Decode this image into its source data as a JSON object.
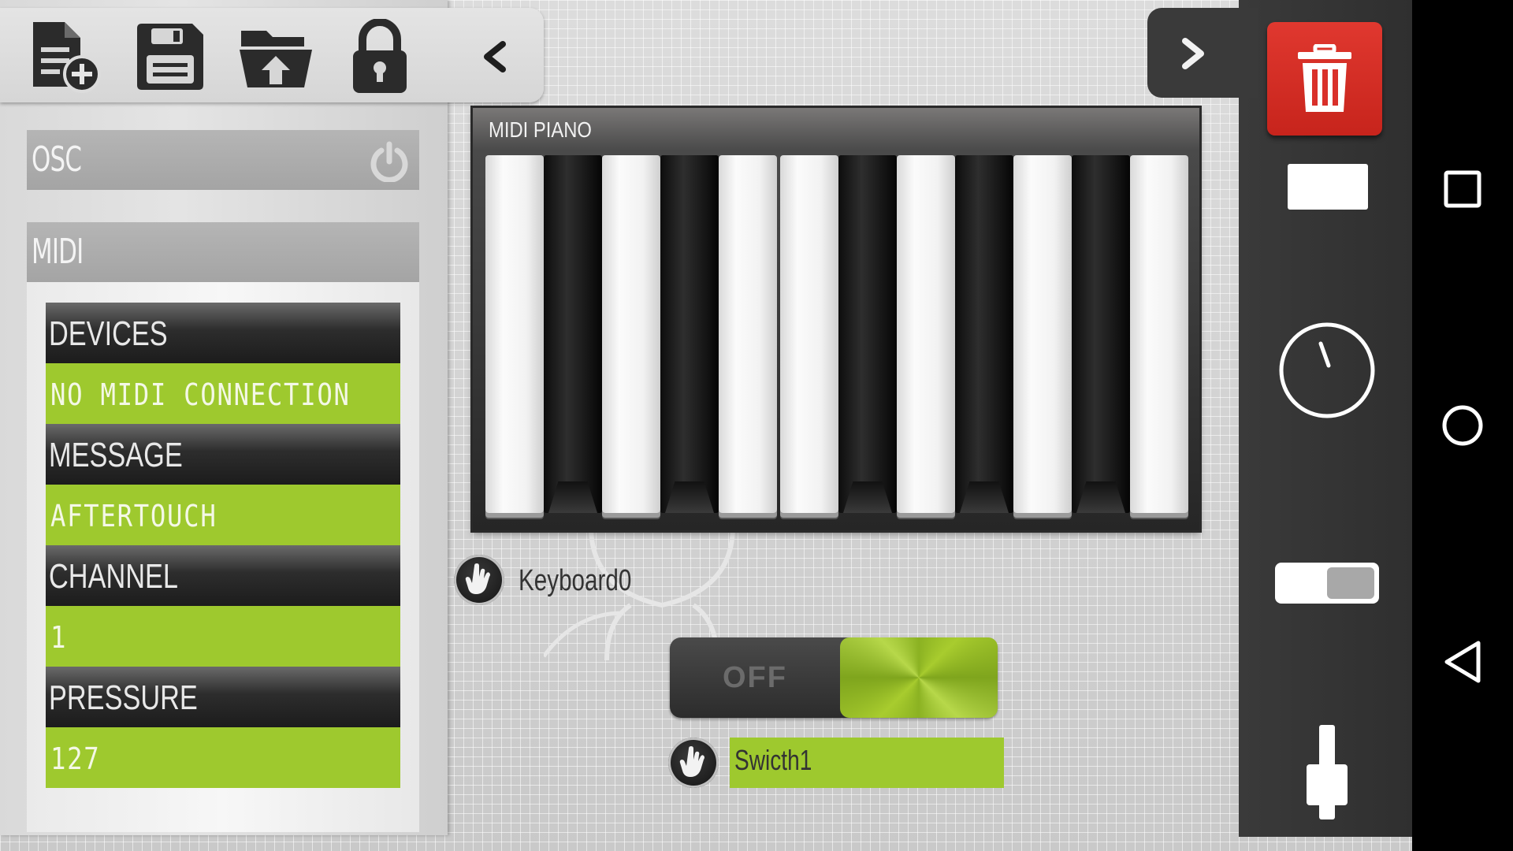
{
  "toolbar": {
    "buttons": [
      {
        "name": "new-file",
        "icon": "file-add-icon"
      },
      {
        "name": "save",
        "icon": "floppy-save-icon"
      },
      {
        "name": "open-folder",
        "icon": "folder-open-icon"
      },
      {
        "name": "lock",
        "icon": "lock-open-icon"
      }
    ],
    "collapse_icon": "chevron-left-icon"
  },
  "left_panel": {
    "osc_header": "OSC",
    "osc_power_icon": "power-icon",
    "midi_header": "MIDI",
    "rows": [
      {
        "label": "DEVICES",
        "value": "NO MIDI CONNECTION"
      },
      {
        "label": "MESSAGE",
        "value": "AFTERTOUCH"
      },
      {
        "label": "CHANNEL",
        "value": "1"
      },
      {
        "label": "PRESSURE",
        "value": "127"
      }
    ]
  },
  "widgets": {
    "piano": {
      "title": "MIDI PIANO",
      "label": "Keyboard0"
    },
    "switch": {
      "state_text": "OFF",
      "label": "Swicth1"
    }
  },
  "right_bar": {
    "expand_icon": "chevron-right-icon",
    "delete_icon": "trash-icon",
    "palette": [
      "button-widget-icon",
      "knob-widget-icon",
      "toggle-widget-icon",
      "slider-widget-icon"
    ]
  },
  "nav": {
    "recents_icon": "square-icon",
    "home_icon": "circle-icon",
    "back_icon": "triangle-back-icon"
  },
  "colors": {
    "accent_green": "#9ec92e",
    "delete_red": "#d9302a",
    "dark_bar": "#333333"
  }
}
